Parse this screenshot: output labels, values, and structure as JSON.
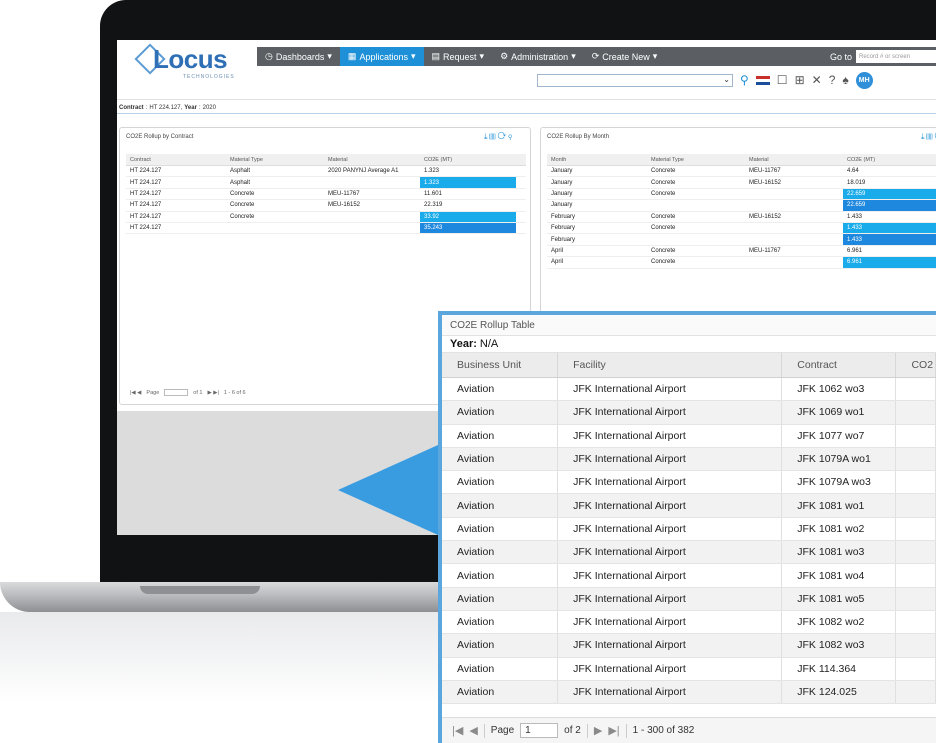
{
  "nav": {
    "dashboards": "Dashboards",
    "applications": "Applications",
    "request": "Request",
    "administration": "Administration",
    "create_new": "Create New",
    "goto_label": "Go to",
    "goto_placeholder": "Record # or screen"
  },
  "brand": {
    "logo": "Locus",
    "sub": "TECHNOLOGIES"
  },
  "user": {
    "initials": "MH"
  },
  "contract_bar": {
    "contract_label": "Contract",
    "contract_value": "HT 224.127,",
    "year_label": "Year",
    "year_value": "2020"
  },
  "panel_contract": {
    "title": "CO2E Rollup by Contract",
    "columns": [
      "Contract",
      "Material Type",
      "Material",
      "CO2E (MT)"
    ],
    "rows": [
      [
        "HT 224.127",
        "Asphalt",
        "2020 PANYNJ Average A1",
        "1.323",
        ""
      ],
      [
        "HT 224.127",
        "Asphalt",
        "",
        "1.323",
        "hl1"
      ],
      [
        "HT 224.127",
        "Concrete",
        "MEU-11767",
        "11.601",
        ""
      ],
      [
        "HT 224.127",
        "Concrete",
        "MEU-16152",
        "22.319",
        ""
      ],
      [
        "HT 224.127",
        "Concrete",
        "",
        "33.92",
        "hl1"
      ],
      [
        "HT 224.127",
        "",
        "",
        "35.243",
        "hl2"
      ]
    ],
    "pager": {
      "page": "Page",
      "of": "of 1",
      "range": "1 - 6 of 6"
    }
  },
  "panel_month": {
    "title": "CO2E Rollup By Month",
    "columns": [
      "Month",
      "Material Type",
      "Material",
      "CO2E (MT)"
    ],
    "rows": [
      [
        "January",
        "Concrete",
        "MEU-11767",
        "4.64",
        ""
      ],
      [
        "January",
        "Concrete",
        "MEU-16152",
        "18.019",
        ""
      ],
      [
        "January",
        "Concrete",
        "",
        "22.659",
        "hl1"
      ],
      [
        "January",
        "",
        "",
        "22.659",
        "hl2"
      ],
      [
        "February",
        "Concrete",
        "MEU-16152",
        "1.433",
        ""
      ],
      [
        "February",
        "Concrete",
        "",
        "1.433",
        "hl1"
      ],
      [
        "February",
        "",
        "",
        "1.433",
        "hl2"
      ],
      [
        "April",
        "Concrete",
        "MEU-11767",
        "6.961",
        ""
      ],
      [
        "April",
        "Concrete",
        "",
        "6.961",
        "hl1"
      ]
    ]
  },
  "rollup_table": {
    "title": "CO2E Rollup Table",
    "year_label": "Year:",
    "year_value": "N/A",
    "columns": [
      "Business Unit",
      "Facility",
      "Contract",
      "CO2"
    ],
    "rows": [
      [
        "Aviation",
        "JFK International Airport",
        "JFK 1062 wo3"
      ],
      [
        "Aviation",
        "JFK International Airport",
        "JFK 1069 wo1"
      ],
      [
        "Aviation",
        "JFK International Airport",
        "JFK 1077 wo7"
      ],
      [
        "Aviation",
        "JFK International Airport",
        "JFK 1079A wo1"
      ],
      [
        "Aviation",
        "JFK International Airport",
        "JFK 1079A wo3"
      ],
      [
        "Aviation",
        "JFK International Airport",
        "JFK 1081 wo1"
      ],
      [
        "Aviation",
        "JFK International Airport",
        "JFK 1081 wo2"
      ],
      [
        "Aviation",
        "JFK International Airport",
        "JFK 1081 wo3"
      ],
      [
        "Aviation",
        "JFK International Airport",
        "JFK 1081 wo4"
      ],
      [
        "Aviation",
        "JFK International Airport",
        "JFK 1081 wo5"
      ],
      [
        "Aviation",
        "JFK International Airport",
        "JFK 1082 wo2"
      ],
      [
        "Aviation",
        "JFK International Airport",
        "JFK 1082 wo3"
      ],
      [
        "Aviation",
        "JFK International Airport",
        "JFK 114.364"
      ],
      [
        "Aviation",
        "JFK International Airport",
        "JFK 124.025"
      ]
    ],
    "pager": {
      "page_label": "Page",
      "page_value": "1",
      "of": "of 2",
      "range": "1 - 300 of 382"
    }
  }
}
